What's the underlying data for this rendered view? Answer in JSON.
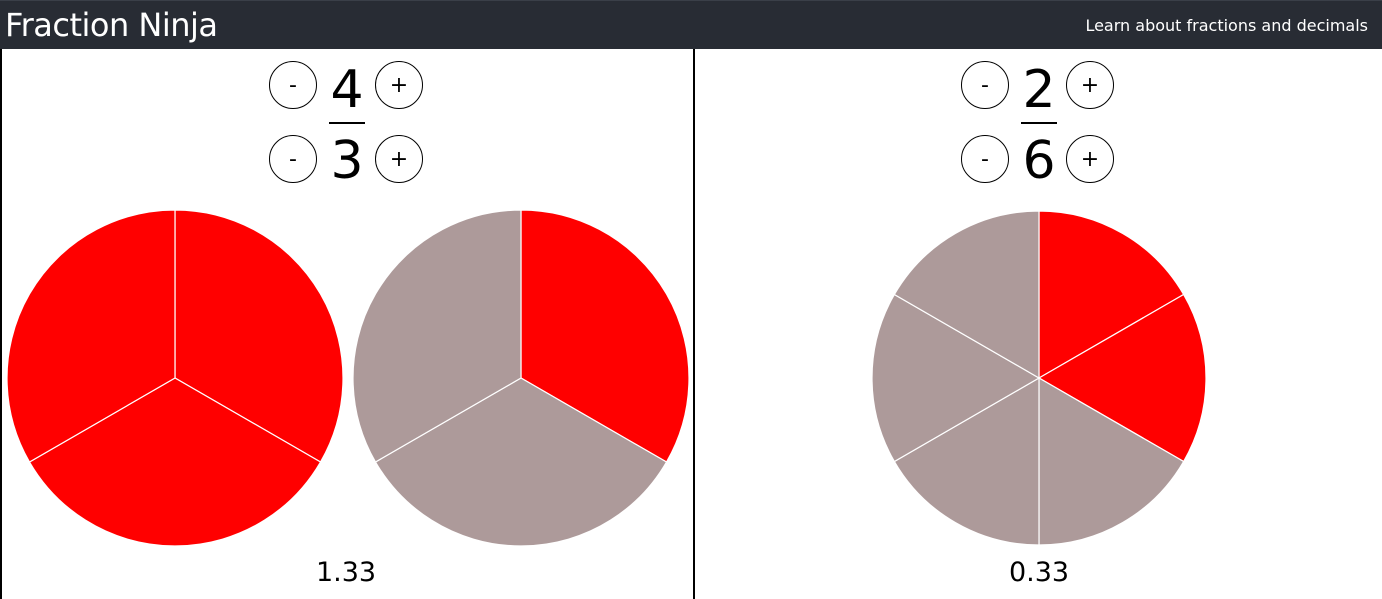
{
  "header": {
    "title": "Fraction Ninja",
    "subtitle": "Learn about fractions and decimals"
  },
  "buttons": {
    "minus": "-",
    "plus": "+"
  },
  "colors": {
    "header_bg": "#282c34",
    "filled": "#ff0000",
    "empty": "#ad9a9a",
    "divider": "#ffffff"
  },
  "fractions": [
    {
      "numerator": 4,
      "denominator": 3,
      "numerator_text": "4",
      "denominator_text": "3",
      "decimal": "1.33"
    },
    {
      "numerator": 2,
      "denominator": 6,
      "numerator_text": "2",
      "denominator_text": "6",
      "decimal": "0.33"
    }
  ]
}
